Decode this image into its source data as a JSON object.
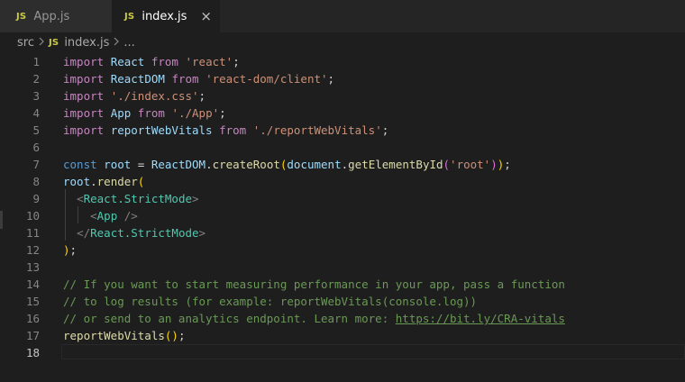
{
  "tabs": [
    {
      "badge": "JS",
      "label": "App.js",
      "active": false
    },
    {
      "badge": "JS",
      "label": "index.js",
      "active": true,
      "close": "×"
    }
  ],
  "breadcrumb": {
    "folder": "src",
    "badge": "JS",
    "file": "index.js",
    "more": "..."
  },
  "icons": {
    "tab_close": "close-icon",
    "breadcrumb_sep": "chevron-right-icon",
    "file": "javascript-file-icon"
  },
  "colors": {
    "background": "#1e1e1e",
    "tab_inactive": "#2d2d2d",
    "js_badge": "#cbcb41",
    "keyword": "#c586c0",
    "variable": "#9cdcfe",
    "string": "#ce9178",
    "function": "#dcdcaa",
    "class": "#4ec9b0",
    "comment": "#6a9955"
  },
  "editor": {
    "current_line": 18,
    "lines": [
      {
        "n": "1",
        "tokens": [
          [
            "kw",
            "import"
          ],
          [
            "pn",
            " "
          ],
          [
            "var",
            "React"
          ],
          [
            "pn",
            " "
          ],
          [
            "kw",
            "from"
          ],
          [
            "pn",
            " "
          ],
          [
            "str",
            "'react'"
          ],
          [
            "pn",
            ";"
          ]
        ]
      },
      {
        "n": "2",
        "tokens": [
          [
            "kw",
            "import"
          ],
          [
            "pn",
            " "
          ],
          [
            "var",
            "ReactDOM"
          ],
          [
            "pn",
            " "
          ],
          [
            "kw",
            "from"
          ],
          [
            "pn",
            " "
          ],
          [
            "str",
            "'react-dom/client'"
          ],
          [
            "pn",
            ";"
          ]
        ]
      },
      {
        "n": "3",
        "tokens": [
          [
            "kw",
            "import"
          ],
          [
            "pn",
            " "
          ],
          [
            "str",
            "'./index.css'"
          ],
          [
            "pn",
            ";"
          ]
        ]
      },
      {
        "n": "4",
        "tokens": [
          [
            "kw",
            "import"
          ],
          [
            "pn",
            " "
          ],
          [
            "var",
            "App"
          ],
          [
            "pn",
            " "
          ],
          [
            "kw",
            "from"
          ],
          [
            "pn",
            " "
          ],
          [
            "str",
            "'./App'"
          ],
          [
            "pn",
            ";"
          ]
        ]
      },
      {
        "n": "5",
        "tokens": [
          [
            "kw",
            "import"
          ],
          [
            "pn",
            " "
          ],
          [
            "var",
            "reportWebVitals"
          ],
          [
            "pn",
            " "
          ],
          [
            "kw",
            "from"
          ],
          [
            "pn",
            " "
          ],
          [
            "str",
            "'./reportWebVitals'"
          ],
          [
            "pn",
            ";"
          ]
        ]
      },
      {
        "n": "6",
        "tokens": []
      },
      {
        "n": "7",
        "tokens": [
          [
            "kw2",
            "const"
          ],
          [
            "pn",
            " "
          ],
          [
            "var",
            "root"
          ],
          [
            "pn",
            " = "
          ],
          [
            "var",
            "ReactDOM"
          ],
          [
            "pn",
            "."
          ],
          [
            "fn",
            "createRoot"
          ],
          [
            "br1",
            "("
          ],
          [
            "var",
            "document"
          ],
          [
            "pn",
            "."
          ],
          [
            "fn",
            "getElementById"
          ],
          [
            "br2",
            "("
          ],
          [
            "str",
            "'root'"
          ],
          [
            "br2",
            ")"
          ],
          [
            "br1",
            ")"
          ],
          [
            "pn",
            ";"
          ]
        ]
      },
      {
        "n": "8",
        "tokens": [
          [
            "var",
            "root"
          ],
          [
            "pn",
            "."
          ],
          [
            "fn",
            "render"
          ],
          [
            "br1",
            "("
          ]
        ]
      },
      {
        "n": "9",
        "tokens": [
          [
            "pn",
            "  "
          ],
          [
            "tagb",
            "<"
          ],
          [
            "cls",
            "React.StrictMode"
          ],
          [
            "tagb",
            ">"
          ]
        ]
      },
      {
        "n": "10",
        "tokens": [
          [
            "pn",
            "    "
          ],
          [
            "tagb",
            "<"
          ],
          [
            "cls",
            "App"
          ],
          [
            "pn",
            " "
          ],
          [
            "tagb",
            "/>"
          ]
        ]
      },
      {
        "n": "11",
        "tokens": [
          [
            "pn",
            "  "
          ],
          [
            "tagb",
            "</"
          ],
          [
            "cls",
            "React.StrictMode"
          ],
          [
            "tagb",
            ">"
          ]
        ]
      },
      {
        "n": "12",
        "tokens": [
          [
            "br1",
            ")"
          ],
          [
            "pn",
            ";"
          ]
        ]
      },
      {
        "n": "13",
        "tokens": []
      },
      {
        "n": "14",
        "tokens": [
          [
            "com",
            "// If you want to start measuring performance in your app, pass a function"
          ]
        ]
      },
      {
        "n": "15",
        "tokens": [
          [
            "com",
            "// to log results (for example: reportWebVitals(console.log))"
          ]
        ]
      },
      {
        "n": "16",
        "tokens": [
          [
            "com",
            "// or send to an analytics endpoint. Learn more: "
          ],
          [
            "link",
            "https://bit.ly/CRA-vitals"
          ]
        ]
      },
      {
        "n": "17",
        "tokens": [
          [
            "fn",
            "reportWebVitals"
          ],
          [
            "br1",
            "()"
          ],
          [
            "pn",
            ";"
          ]
        ]
      },
      {
        "n": "18",
        "tokens": []
      }
    ]
  }
}
